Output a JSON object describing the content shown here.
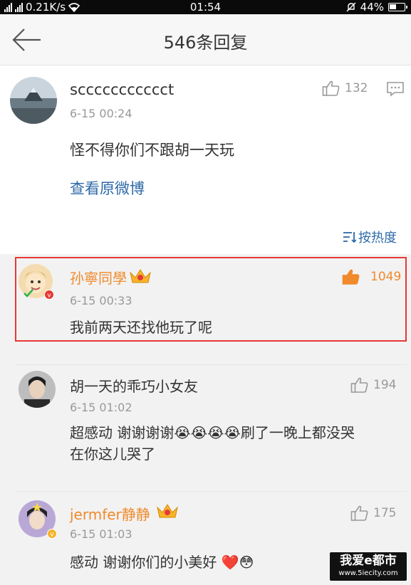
{
  "status_bar": {
    "speed": "0.21K/s",
    "time": "01:54",
    "battery": "44%"
  },
  "header": {
    "title": "546条回复"
  },
  "main_post": {
    "username": "sccccccccccct",
    "time": "6-15 00:24",
    "text": "怪不得你们不跟胡一天玩",
    "link": "查看原微博",
    "like_count": "132"
  },
  "sort": {
    "label": "按热度"
  },
  "replies": [
    {
      "username": "孙寧同學",
      "time": "6-15 00:33",
      "text": "我前两天还找他玩了呢",
      "like_count": "1049",
      "liked": true,
      "highlighted": true
    },
    {
      "username": "胡一天的乖巧小女友",
      "time": "6-15 01:02",
      "text_line1": "超感动 谢谢谢谢😭😭😭😭刷了一晚上都没哭",
      "text_line2": "在你这儿哭了",
      "like_count": "194"
    },
    {
      "username": "jermfer静静",
      "time": "6-15 01:03",
      "text": "感动 谢谢你们的小美好 ❤️😳",
      "like_count": "175"
    }
  ],
  "watermark": {
    "line1": "我爱e都市",
    "line2": "www.5iecity.com"
  },
  "colors": {
    "accent_orange": "#f08a2c",
    "link_blue": "#2e6aa8",
    "highlight_red": "#e53935"
  }
}
